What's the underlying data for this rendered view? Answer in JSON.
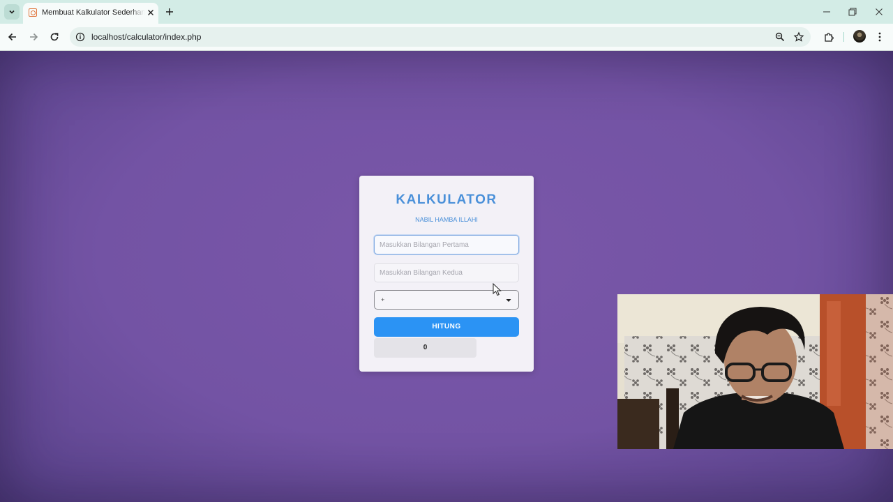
{
  "browser": {
    "tab_title": "Membuat Kalkulator Sederhana",
    "url": "localhost/calculator/index.php",
    "icons": {
      "tab_search": "chevron-down-icon",
      "favicon": "xampp-favicon-icon",
      "tab_close": "close-icon",
      "new_tab": "plus-icon",
      "back": "back-arrow-icon",
      "forward": "forward-arrow-icon",
      "reload": "reload-icon",
      "site_info": "info-icon",
      "zoom": "zoom-icon",
      "bookmark": "star-icon",
      "extensions": "puzzle-icon",
      "menu": "kebab-menu-icon",
      "minimize": "minimize-icon",
      "restore": "restore-icon",
      "close_window": "close-icon"
    }
  },
  "calculator": {
    "title": "KALKULATOR",
    "subtitle": "NABIL HAMBA ILLAHI",
    "input1_placeholder": "Masukkan Bilangan Pertama",
    "input2_placeholder": "Masukkan Bilangan Kedua",
    "operator_selected": "+",
    "button_label": "HITUNG",
    "result": "0"
  },
  "colors": {
    "accent": "#4a90d9",
    "button": "#2b93f4",
    "page_background": "#7353a4",
    "tabstrip": "#d3ece6"
  }
}
